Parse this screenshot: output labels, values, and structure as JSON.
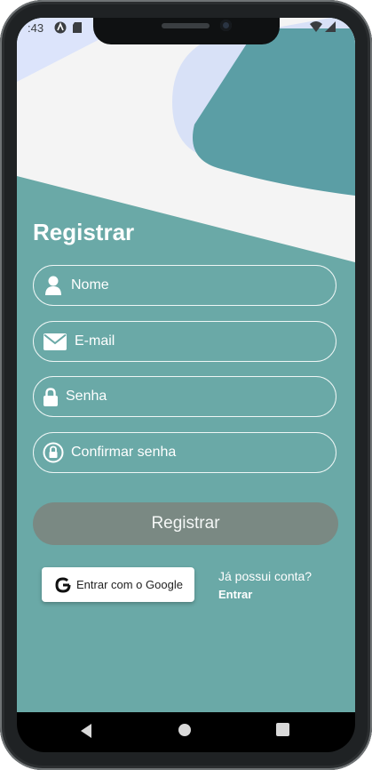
{
  "status_bar": {
    "time": ":43"
  },
  "register": {
    "title": "Registrar",
    "fields": [
      {
        "label": "Nome",
        "icon": "user-icon"
      },
      {
        "label": "E-mail",
        "icon": "envelope-icon"
      },
      {
        "label": "Senha",
        "icon": "lock-icon"
      },
      {
        "label": "Confirmar senha",
        "icon": "lock-circle-icon"
      }
    ],
    "submit_label": "Registrar",
    "google_label": "Entrar com o Google",
    "login_question": "Já possui conta?",
    "login_link": "Entrar"
  },
  "nav": {
    "items": [
      "back-icon",
      "home-icon",
      "recents-icon"
    ]
  },
  "colors": {
    "background": "#6aa9a7",
    "deco_light": "#dce4fb",
    "deco_accent": "#5b9ea5",
    "submit": "#7a8983"
  }
}
